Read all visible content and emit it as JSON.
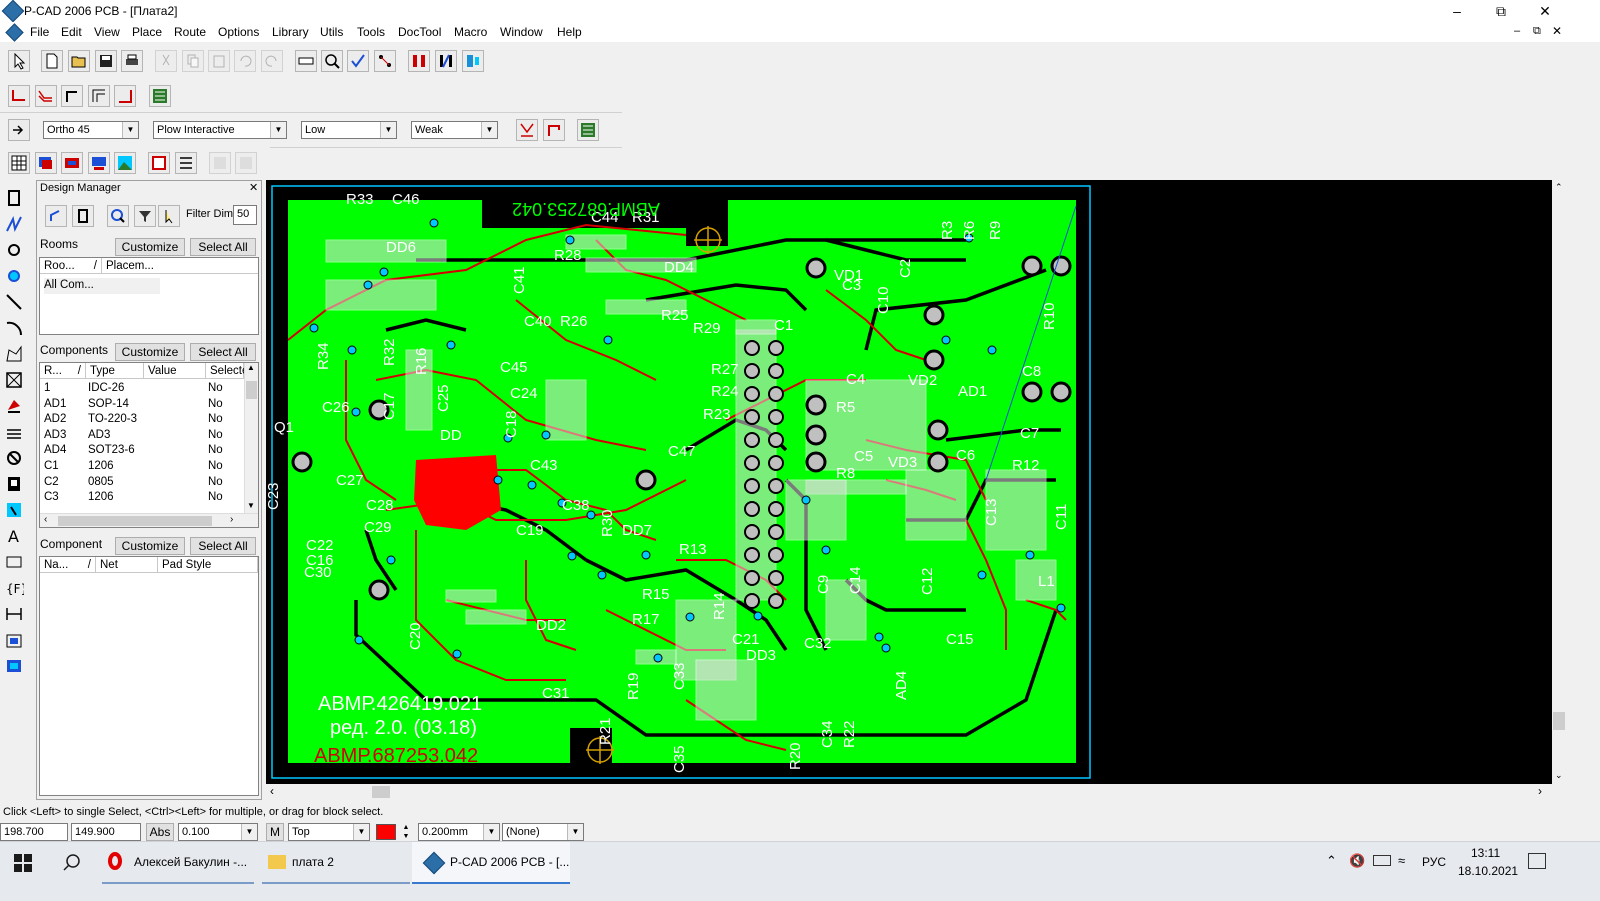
{
  "window": {
    "title": "P-CAD 2006 PCB - [Плата2]"
  },
  "menu": [
    "File",
    "Edit",
    "View",
    "Place",
    "Route",
    "Options",
    "Library",
    "Utils",
    "Tools",
    "DocTool",
    "Macro",
    "Window",
    "Help"
  ],
  "route_toolbar": {
    "mode": "Ortho 45",
    "interactive": "Plow Interactive",
    "level": "Low",
    "strength": "Weak"
  },
  "design_manager": {
    "title": "Design Manager",
    "filter_label": "Filter Dim:",
    "filter_value": "50",
    "rooms": {
      "label": "Rooms",
      "customize": "Customize",
      "select_all": "Select All",
      "columns": [
        "Roo...",
        "Placem..."
      ],
      "rows": [
        "All Com..."
      ]
    },
    "components": {
      "label": "Components",
      "customize": "Customize",
      "select_all": "Select All",
      "columns": [
        "R...",
        "Type",
        "Value",
        "Selecte"
      ],
      "rows": [
        {
          "ref": "1",
          "type": "IDC-26",
          "sel": "No"
        },
        {
          "ref": "AD1",
          "type": "SOP-14",
          "sel": "No"
        },
        {
          "ref": "AD2",
          "type": "TO-220-3",
          "sel": "No"
        },
        {
          "ref": "AD3",
          "type": "AD3",
          "sel": "No"
        },
        {
          "ref": "AD4",
          "type": "SOT23-6",
          "sel": "No"
        },
        {
          "ref": "C1",
          "type": "1206",
          "sel": "No"
        },
        {
          "ref": "C2",
          "type": "0805",
          "sel": "No"
        },
        {
          "ref": "C3",
          "type": "1206",
          "sel": "No"
        }
      ]
    },
    "component_pads": {
      "label": "Component",
      "customize": "Customize",
      "select_all": "Select All",
      "columns": [
        "Na...",
        "Net",
        "Pad Style"
      ]
    }
  },
  "pcb": {
    "labels": [
      "R33",
      "C46",
      "DD6",
      "C44",
      "R31",
      "R28",
      "DD4",
      "C41",
      "C40",
      "R26",
      "R25",
      "R29",
      "R27",
      "R24",
      "R23",
      "R34",
      "R32",
      "R16",
      "C26",
      "C45",
      "C24",
      "C25",
      "C17",
      "C18",
      "DD",
      "C43",
      "C47",
      "C38",
      "DD7",
      "R13",
      "R30",
      "C19",
      "C27",
      "C28",
      "C29",
      "C22",
      "C16",
      "C30",
      "C23",
      "C20",
      "DD2",
      "R15",
      "R17",
      "C21",
      "R14",
      "DD3",
      "C32",
      "R19",
      "C33",
      "C31",
      "R21",
      "C35",
      "R20",
      "C34",
      "R22",
      "AD4",
      "VD1",
      "C3",
      "C10",
      "C2",
      "R3",
      "R6",
      "R9",
      "R10",
      "C4",
      "VD2",
      "AD1",
      "C8",
      "C7",
      "R5",
      "C5",
      "VD3",
      "C6",
      "R12",
      "R8",
      "C9",
      "C14",
      "C12",
      "C13",
      "C11",
      "L1",
      "C15",
      "Q1",
      "C1"
    ],
    "top_mirror_text": "АВМР.687253.042",
    "text_line1": "АВМР.426419.021",
    "text_line2": "ред. 2.0. (03.18)",
    "red_text": "АВМР.687253.042"
  },
  "status": {
    "hint": "Click <Left> to single Select, <Ctrl><Left> for multiple, or drag for block select.",
    "x": "198.700",
    "y": "149.900",
    "abs": "Abs",
    "grid": "0.100",
    "layer_lock": "M",
    "layer": "Top",
    "width": "0.200mm",
    "net": "(None)"
  },
  "taskbar": {
    "item1": "Алексей Бакулин -...",
    "item2": "плата 2",
    "item3": "P-CAD 2006 PCB - [...",
    "lang": "РУС",
    "time": "13:11",
    "date": "18.10.2021"
  },
  "colors": {
    "board": "#00ff00",
    "track_red": "#d40000",
    "track_black": "#000000",
    "pad_cyan": "#00c8ff",
    "text_white": "#ffffff"
  }
}
